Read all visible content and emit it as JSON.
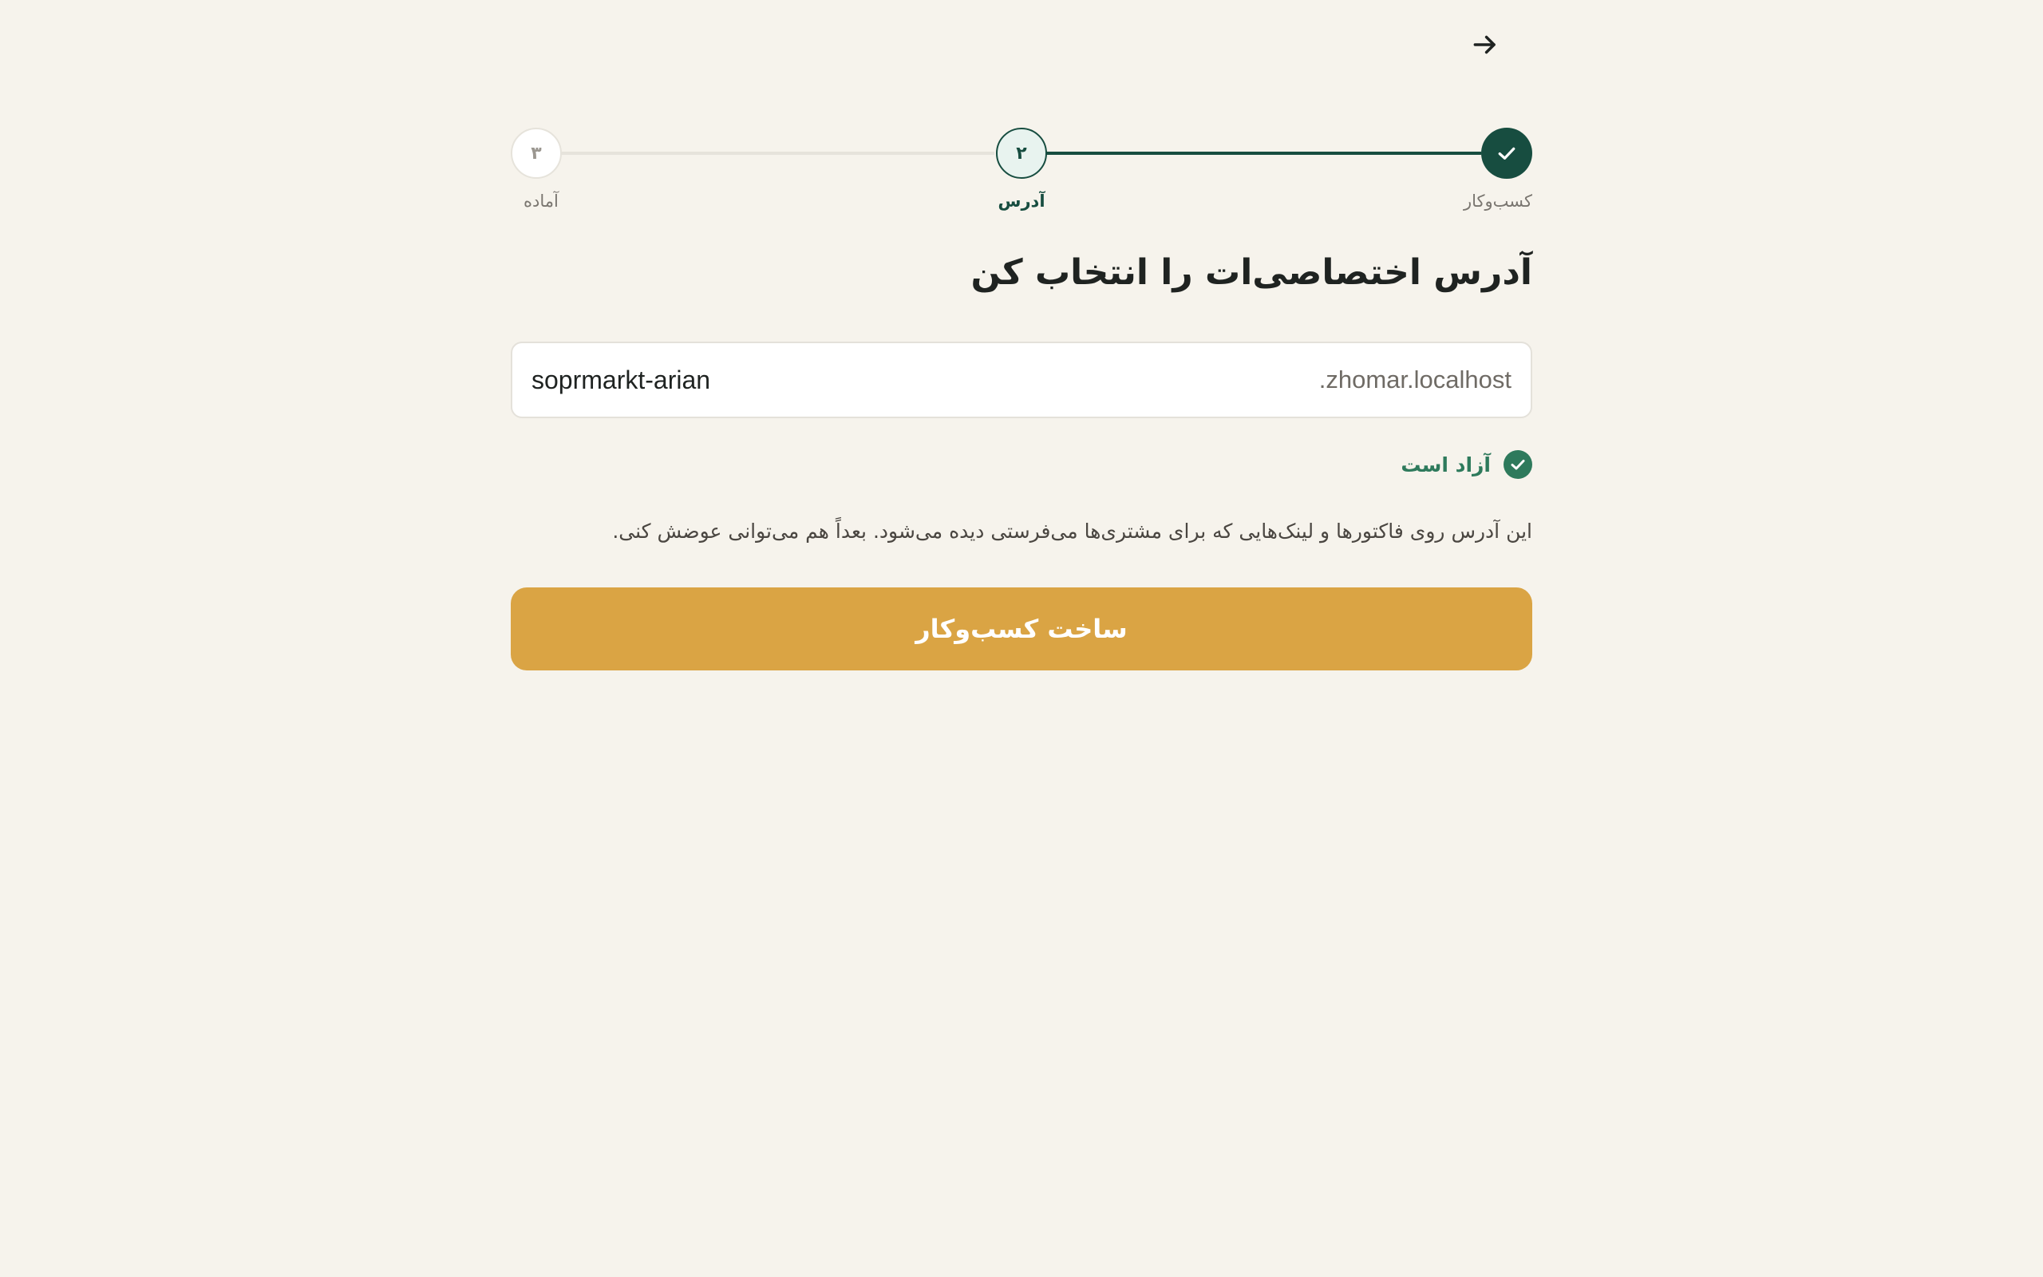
{
  "nav": {
    "back_icon": "arrow-right-icon"
  },
  "stepper": {
    "steps": [
      {
        "label": "کسب‌وکار",
        "number": "",
        "state": "done",
        "icon": "check-icon"
      },
      {
        "label": "آدرس",
        "number": "۲",
        "state": "active"
      },
      {
        "label": "آماده",
        "number": "۳",
        "state": "upcoming"
      }
    ]
  },
  "main": {
    "title": "آدرس اختصاصی‌ات را انتخاب کن",
    "address": {
      "value": "soprmarkt-arian",
      "suffix": ".zhomar.localhost"
    },
    "availability": {
      "text": "آزاد است",
      "icon": "check-circle-icon"
    },
    "hint": "این آدرس روی فاکتورها و لینک‌هایی که برای مشتری‌ها می‌فرستی دیده می‌شود. بعداً هم می‌توانی عوضش کنی.",
    "submit_label": "ساخت کسب‌وکار"
  },
  "colors": {
    "background": "#f6f3ec",
    "primary": "#174d40",
    "success": "#2e7a5c",
    "accent": "#daa444"
  }
}
